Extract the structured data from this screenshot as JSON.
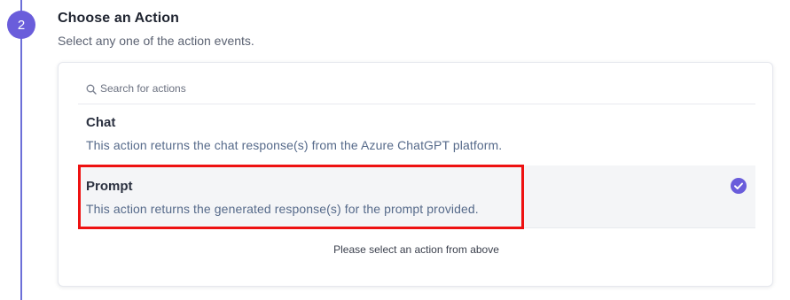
{
  "step": {
    "number": "2",
    "title": "Choose an Action",
    "subtitle": "Select any one of the action events."
  },
  "search": {
    "placeholder": "Search for actions",
    "value": "",
    "icon": "search-icon"
  },
  "actions": [
    {
      "title": "Chat",
      "description": "This action returns the chat response(s) from the Azure ChatGPT platform.",
      "selected": false
    },
    {
      "title": "Prompt",
      "description": "This action returns the generated response(s) for the prompt provided.",
      "selected": true,
      "icon": "check-circle-icon"
    }
  ],
  "footer": {
    "hint": "Please select an action from above"
  },
  "colors": {
    "accent": "#6a5ddb",
    "selected_bg": "#f4f5f7",
    "highlight_border": "#ee1111"
  }
}
